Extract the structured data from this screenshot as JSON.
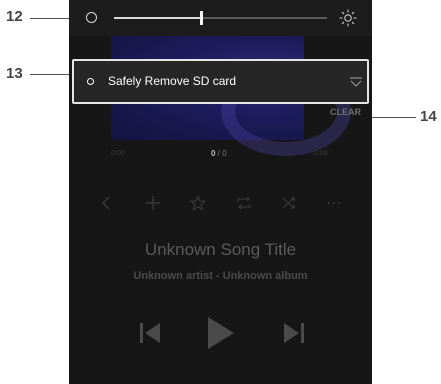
{
  "callouts": {
    "brightness": "12",
    "notification": "13",
    "clear": "14"
  },
  "quick_panel": {
    "brightness_level": 0.41
  },
  "notification": {
    "text": "Safely Remove SD card"
  },
  "clear_label": "CLEAR",
  "player": {
    "time_current": "0:00",
    "time_total": "0:00",
    "track_index": "0",
    "track_count": "0",
    "song_title": "Unknown Song Title",
    "artist_album": "Unknown artist - Unknown album"
  },
  "icons": {
    "toolbar": [
      "chevron-left-icon",
      "plus-icon",
      "star-icon",
      "repeat-icon",
      "shuffle-icon",
      "more-icon"
    ],
    "controls": [
      "previous-icon",
      "play-icon",
      "next-icon"
    ]
  },
  "colors": {
    "device_bg": "#161616",
    "notification_border": "#e6e6e6",
    "album_art": "#1c1b5a"
  }
}
